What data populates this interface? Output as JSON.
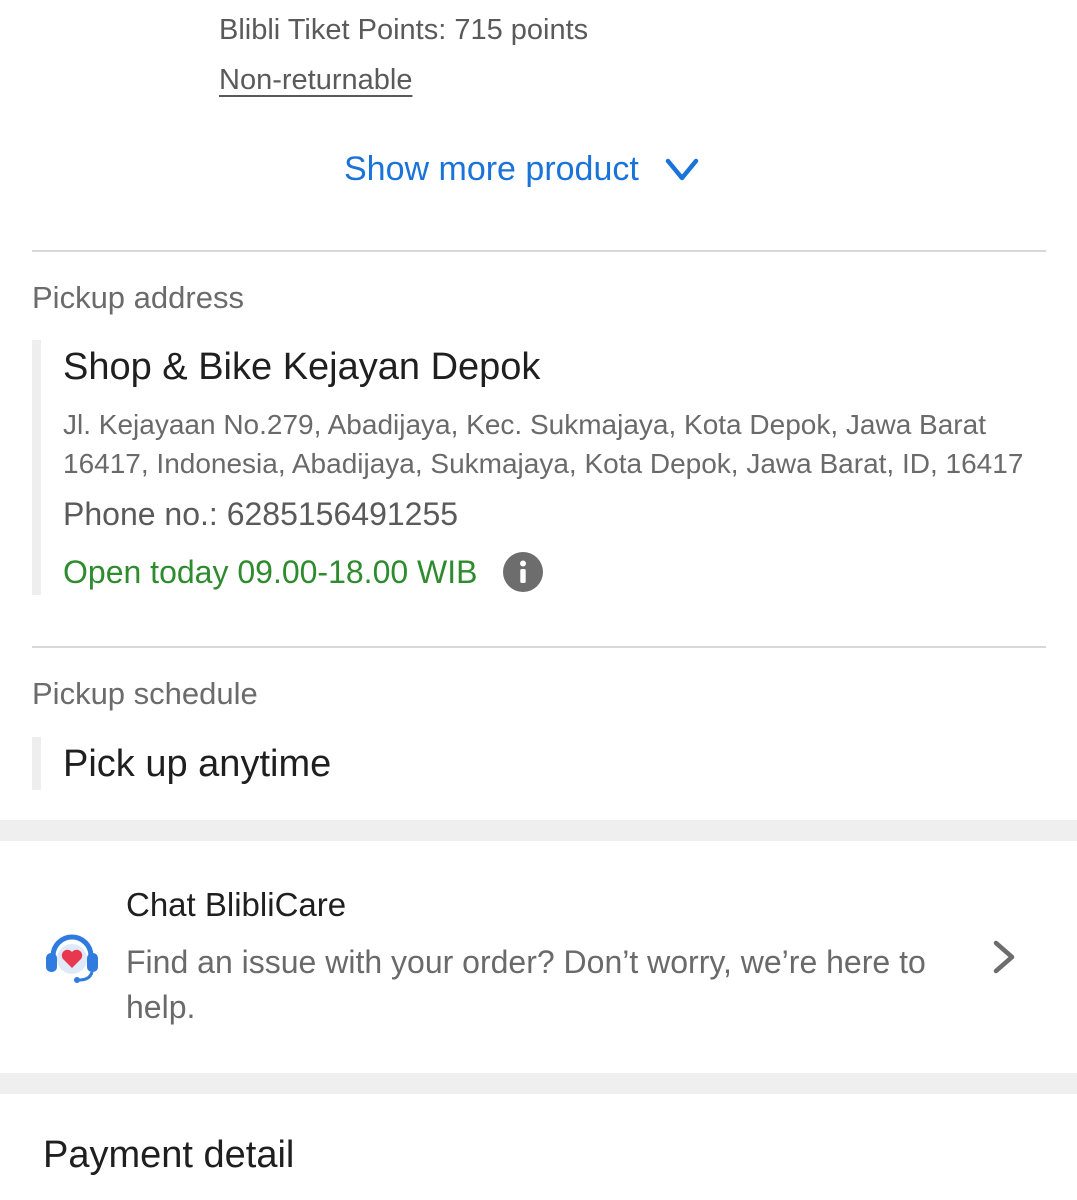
{
  "product": {
    "points": "Blibli Tiket Points: 715 points",
    "return_policy": "Non-returnable"
  },
  "show_more": {
    "label": "Show more product",
    "icon": "chevron-down-icon"
  },
  "pickup_address": {
    "label": "Pickup address",
    "store_name": "Shop & Bike Kejayan Depok",
    "address": "Jl. Kejayaan No.279, Abadijaya, Kec. Sukmajaya, Kota Depok, Jawa Barat 16417, Indonesia, Abadijaya, Sukmajaya, Kota Depok, Jawa Barat, ID, 16417",
    "phone": "Phone no.: 6285156491255",
    "open_hours": "Open today 09.00-18.00 WIB",
    "info_icon": "info-icon"
  },
  "pickup_schedule": {
    "label": "Pickup schedule",
    "value": "Pick up anytime"
  },
  "chat": {
    "title": "Chat BlibliCare",
    "description": "Find an issue with your order? Don’t worry, we’re here to help.",
    "icon": "headset-heart-icon",
    "chevron": "chevron-right-icon"
  },
  "payment": {
    "title": "Payment detail"
  },
  "colors": {
    "link_blue": "#1a73d9",
    "open_green": "#2e8b2e",
    "chat_icon_blue": "#2f7be0",
    "chat_icon_red": "#e8384f"
  }
}
